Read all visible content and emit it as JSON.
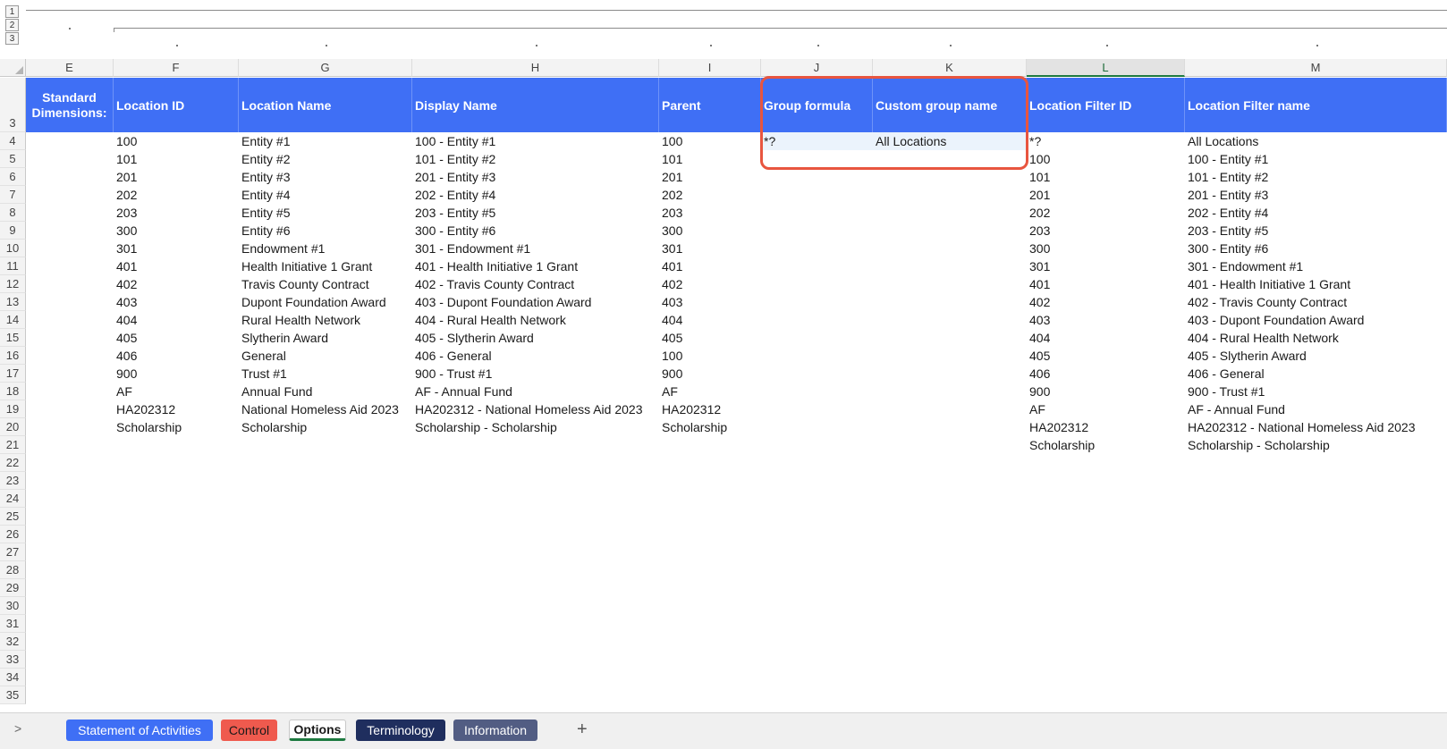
{
  "outline": {
    "levels": [
      "1",
      "2",
      "3"
    ]
  },
  "columns": [
    "E",
    "F",
    "G",
    "H",
    "I",
    "J",
    "K",
    "L",
    "M"
  ],
  "selected_column": "L",
  "rows": [
    "3",
    "4",
    "5",
    "6",
    "7",
    "8",
    "9",
    "10",
    "11",
    "12",
    "13",
    "14",
    "15",
    "16",
    "17",
    "18",
    "19",
    "20",
    "21",
    "22",
    "23",
    "24",
    "25",
    "26",
    "27",
    "28",
    "29",
    "30",
    "31",
    "32",
    "33",
    "34",
    "35"
  ],
  "headers": {
    "E": "Standard Dimensions:",
    "F": "Location ID",
    "G": "Location Name",
    "H": "Display Name",
    "I": "Parent",
    "J": "Group formula",
    "K": "Custom group name",
    "L": "Location Filter ID",
    "M": "Location Filter name"
  },
  "table": [
    [
      "100",
      "Entity #1",
      "100 - Entity #1",
      "100"
    ],
    [
      "101",
      "Entity #2",
      "101 - Entity #2",
      "101"
    ],
    [
      "201",
      "Entity #3",
      "201 - Entity #3",
      "201"
    ],
    [
      "202",
      "Entity #4",
      "202 - Entity #4",
      "202"
    ],
    [
      "203",
      "Entity #5",
      "203 - Entity #5",
      "203"
    ],
    [
      "300",
      "Entity #6",
      "300 - Entity #6",
      "300"
    ],
    [
      "301",
      "Endowment #1",
      "301 - Endowment #1",
      "301"
    ],
    [
      "401",
      "Health Initiative 1 Grant",
      "401 - Health Initiative 1 Grant",
      "401"
    ],
    [
      "402",
      "Travis County Contract",
      "402 - Travis County Contract",
      "402"
    ],
    [
      "403",
      "Dupont Foundation Award",
      "403 - Dupont Foundation Award",
      "403"
    ],
    [
      "404",
      "Rural Health Network",
      "404 - Rural Health Network",
      "404"
    ],
    [
      "405",
      "Slytherin Award",
      "405 - Slytherin Award",
      "405"
    ],
    [
      "406",
      "General",
      "406 - General",
      "100"
    ],
    [
      "900",
      "Trust #1",
      "900 - Trust #1",
      "900"
    ],
    [
      "AF",
      "Annual Fund",
      "AF - Annual Fund",
      "AF"
    ],
    [
      "HA202312",
      "National Homeless Aid 2023",
      "HA202312 - National Homeless Aid 2023",
      "HA202312"
    ],
    [
      "Scholarship",
      "Scholarship",
      "Scholarship - Scholarship",
      "Scholarship"
    ]
  ],
  "group": {
    "formula": "*?",
    "custom_name": "All Locations"
  },
  "filter": [
    [
      "*?",
      "All Locations"
    ],
    [
      "100",
      "100 - Entity #1"
    ],
    [
      "101",
      "101 - Entity #2"
    ],
    [
      "201",
      "201 - Entity #3"
    ],
    [
      "202",
      "202 - Entity #4"
    ],
    [
      "203",
      "203 - Entity #5"
    ],
    [
      "300",
      "300 - Entity #6"
    ],
    [
      "301",
      "301 - Endowment #1"
    ],
    [
      "401",
      "401 - Health Initiative 1 Grant"
    ],
    [
      "402",
      "402 - Travis County Contract"
    ],
    [
      "403",
      "403 - Dupont Foundation Award"
    ],
    [
      "404",
      "404 - Rural Health Network"
    ],
    [
      "405",
      "405 - Slytherin Award"
    ],
    [
      "406",
      "406 - General"
    ],
    [
      "900",
      "900 - Trust #1"
    ],
    [
      "AF",
      "AF - Annual Fund"
    ],
    [
      "HA202312",
      "HA202312 - National Homeless Aid 2023"
    ],
    [
      "Scholarship",
      "Scholarship - Scholarship"
    ]
  ],
  "sheet_nav": ">",
  "tabs": [
    {
      "label": "Statement of Activities",
      "bg": "#3f6ff5",
      "fg": "#ffffff",
      "active": false
    },
    {
      "label": "Control",
      "bg": "#ef5a4e",
      "fg": "#1a1a1a",
      "active": false
    },
    {
      "label": "Options",
      "bg": "#ffffff",
      "fg": "#1a1a1a",
      "active": true
    },
    {
      "label": "Terminology",
      "bg": "#1f2e5e",
      "fg": "#ffffff",
      "active": false
    },
    {
      "label": "Information",
      "bg": "#525d83",
      "fg": "#ffffff",
      "active": false
    }
  ],
  "add_sheet": "+",
  "colors": {
    "header_band": "#3f6ff5",
    "highlight_box": "#e8553f",
    "selected_col": "#1d7a40"
  }
}
